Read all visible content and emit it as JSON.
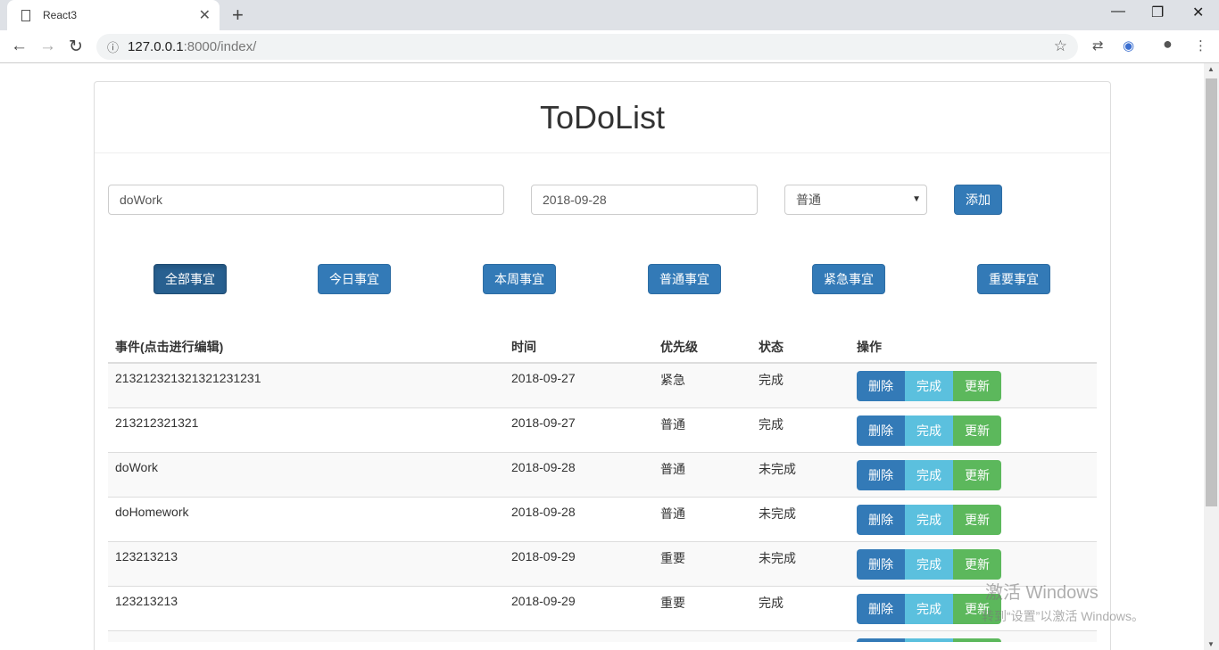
{
  "browser": {
    "tab_title": "React3",
    "url_host": "127.0.0.1",
    "url_rest": ":8000/index/"
  },
  "page": {
    "title": "ToDoList"
  },
  "form": {
    "task_value": "doWork",
    "date_value": "2018-09-28",
    "priority_selected": "普通",
    "add_label": "添加"
  },
  "filters": [
    {
      "label": "全部事宜",
      "active": true
    },
    {
      "label": "今日事宜"
    },
    {
      "label": "本周事宜"
    },
    {
      "label": "普通事宜"
    },
    {
      "label": "紧急事宜"
    },
    {
      "label": "重要事宜"
    }
  ],
  "table": {
    "headers": [
      "事件(点击进行编辑)",
      "时间",
      "优先级",
      "状态",
      "操作"
    ],
    "actions": {
      "delete": "删除",
      "done": "完成",
      "update": "更新"
    },
    "rows": [
      {
        "task": "213212321321321231231",
        "date": "2018-09-27",
        "priority": "紧急",
        "status": "完成"
      },
      {
        "task": "213212321321",
        "date": "2018-09-27",
        "priority": "普通",
        "status": "完成"
      },
      {
        "task": "doWork",
        "date": "2018-09-28",
        "priority": "普通",
        "status": "未完成"
      },
      {
        "task": "doHomework",
        "date": "2018-09-28",
        "priority": "普通",
        "status": "未完成"
      },
      {
        "task": "123213213",
        "date": "2018-09-29",
        "priority": "重要",
        "status": "未完成"
      },
      {
        "task": "123213213",
        "date": "2018-09-29",
        "priority": "重要",
        "status": "完成"
      }
    ]
  },
  "watermark": {
    "line1": "激活 Windows",
    "line2": "转到“设置”以激活 Windows。"
  },
  "colors": {
    "primary": "#337ab7",
    "info": "#5bc0de",
    "success": "#5cb85c"
  }
}
